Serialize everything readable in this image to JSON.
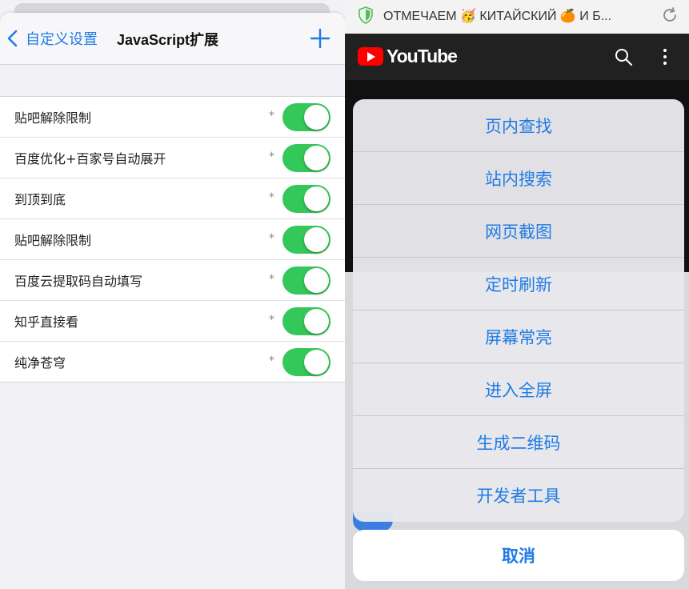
{
  "settings": {
    "back_label": "自定义设置",
    "title": "JavaScript扩展",
    "items": [
      {
        "label": "贴吧解除限制",
        "marker": "*",
        "enabled": true
      },
      {
        "label": "百度优化+百家号自动展开",
        "marker": "*",
        "enabled": true
      },
      {
        "label": "到顶到底",
        "marker": "*",
        "enabled": true
      },
      {
        "label": "贴吧解除限制",
        "marker": "*",
        "enabled": true
      },
      {
        "label": "百度云提取码自动填写",
        "marker": "*",
        "enabled": true
      },
      {
        "label": "知乎直接看",
        "marker": "*",
        "enabled": true
      },
      {
        "label": "纯净苍穹",
        "marker": "*",
        "enabled": true
      }
    ]
  },
  "browser": {
    "url_text": "ОТМЕЧАЕМ 🥳 КИТАЙСКИЙ 🍊 И Б...",
    "site_name": "YouTube"
  },
  "action_sheet": {
    "items": [
      "页内查找",
      "站内搜索",
      "网页截图",
      "定时刷新",
      "屏幕常亮",
      "进入全屏",
      "生成二维码",
      "开发者工具"
    ],
    "cancel_label": "取消"
  },
  "colors": {
    "accent": "#1f7be4",
    "toggle_on": "#34c759",
    "youtube_red": "#ff0000"
  }
}
